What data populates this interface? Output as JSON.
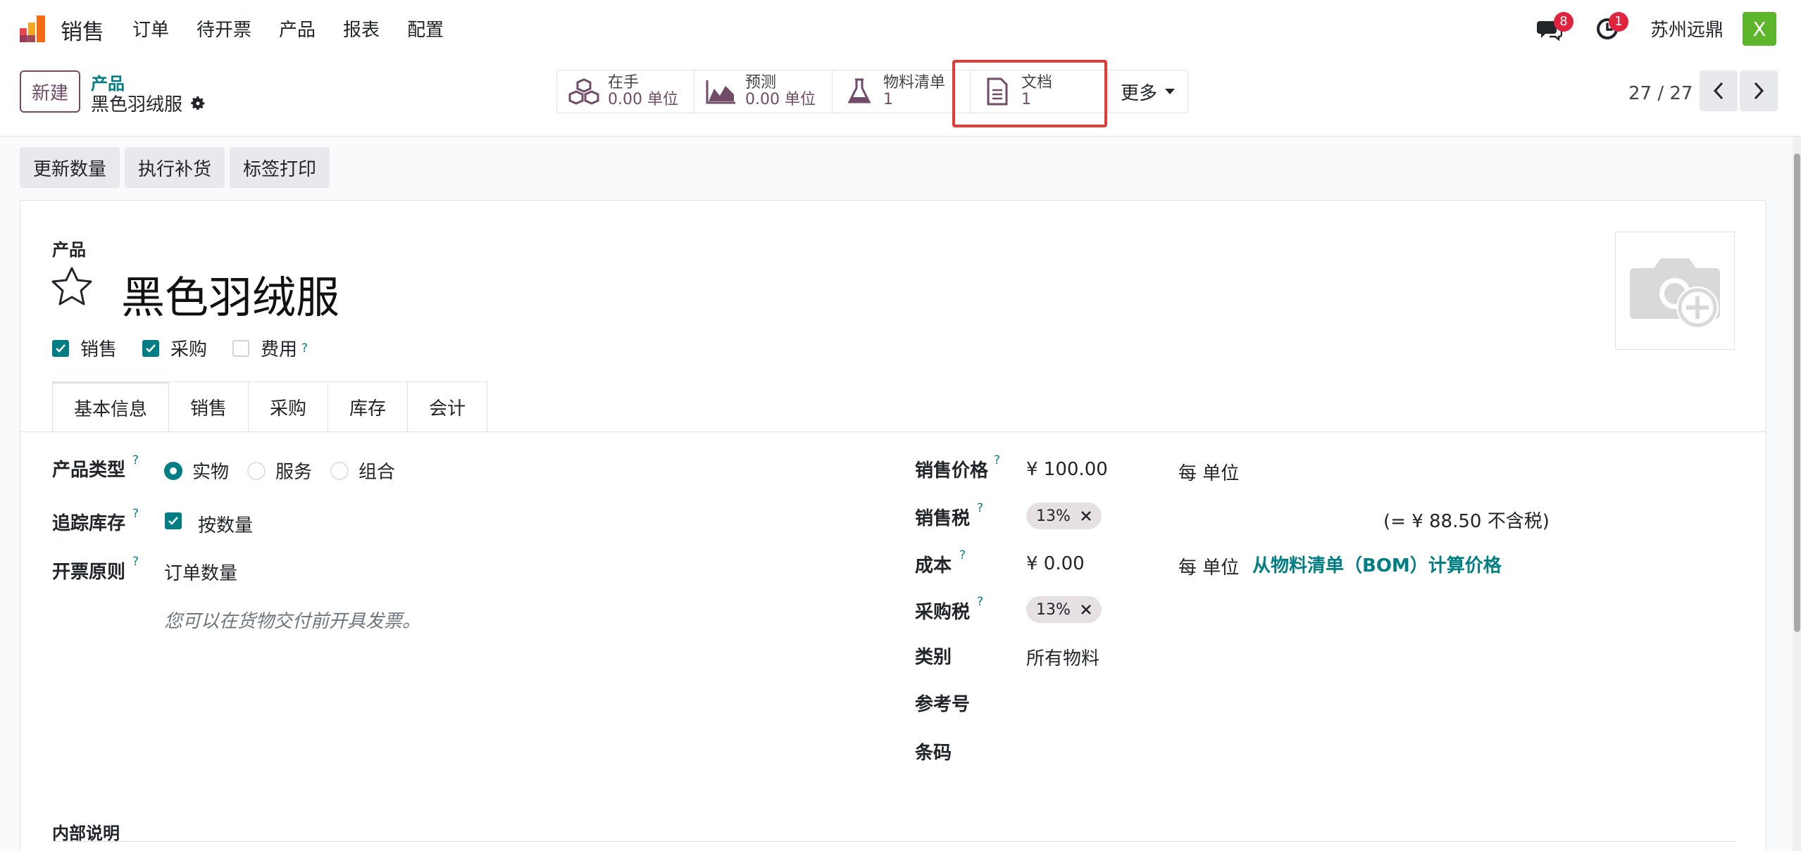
{
  "navbar": {
    "app_name": "销售",
    "menu": [
      "订单",
      "待开票",
      "产品",
      "报表",
      "配置"
    ],
    "chat_badge": "8",
    "activity_badge": "1",
    "company": "苏州远鼎",
    "avatar_letter": "X"
  },
  "control_panel": {
    "new_button": "新建",
    "breadcrumb_parent": "产品",
    "breadcrumb_current": "黑色羽绒服",
    "smart_buttons": [
      {
        "icon": "cubes-icon",
        "label": "在手",
        "value": "0.00 单位"
      },
      {
        "icon": "area-chart-icon",
        "label": "预测",
        "value": "0.00 单位"
      },
      {
        "icon": "flask-icon",
        "label": "物料清单",
        "value": "1"
      },
      {
        "icon": "document-icon",
        "label": "文档",
        "value": "1"
      }
    ],
    "more_label": "更多",
    "pager": "27 / 27"
  },
  "action_bar": [
    "更新数量",
    "执行补货",
    "标签打印"
  ],
  "form": {
    "caption": "产品",
    "title": "黑色羽绒服",
    "checkboxes": [
      {
        "label": "销售",
        "checked": true
      },
      {
        "label": "采购",
        "checked": true
      },
      {
        "label": "费用",
        "checked": false
      }
    ],
    "help_mark": "?",
    "tabs": [
      "基本信息",
      "销售",
      "采购",
      "库存",
      "会计"
    ],
    "left": {
      "product_type_label": "产品类型",
      "product_type_options": [
        "实物",
        "服务",
        "组合"
      ],
      "track_inventory_label": "追踪库存",
      "track_inventory_value": "按数量",
      "invoice_policy_label": "开票原则",
      "invoice_policy_value": "订单数量",
      "invoice_note": "您可以在货物交付前开具发票。"
    },
    "right": {
      "sales_price_label": "销售价格",
      "sales_price_value": "¥ 100.00",
      "sales_price_unit": "每 单位",
      "sales_tax_label": "销售税",
      "sales_tax_tag": "13%",
      "sales_tax_note": "(= ¥ 88.50 不含税)",
      "cost_label": "成本",
      "cost_value": "¥ 0.00",
      "cost_unit": "每 单位",
      "bom_link": "从物料清单（BOM）计算价格",
      "purchase_tax_label": "采购税",
      "purchase_tax_tag": "13%",
      "category_label": "类别",
      "category_value": "所有物料",
      "reference_label": "参考号",
      "barcode_label": "条码"
    },
    "internal_notes_title": "内部说明"
  },
  "colors": {
    "brand": "#714b67",
    "accent": "#017e84",
    "badge": "#e0243d",
    "highlight": "#e53935"
  }
}
